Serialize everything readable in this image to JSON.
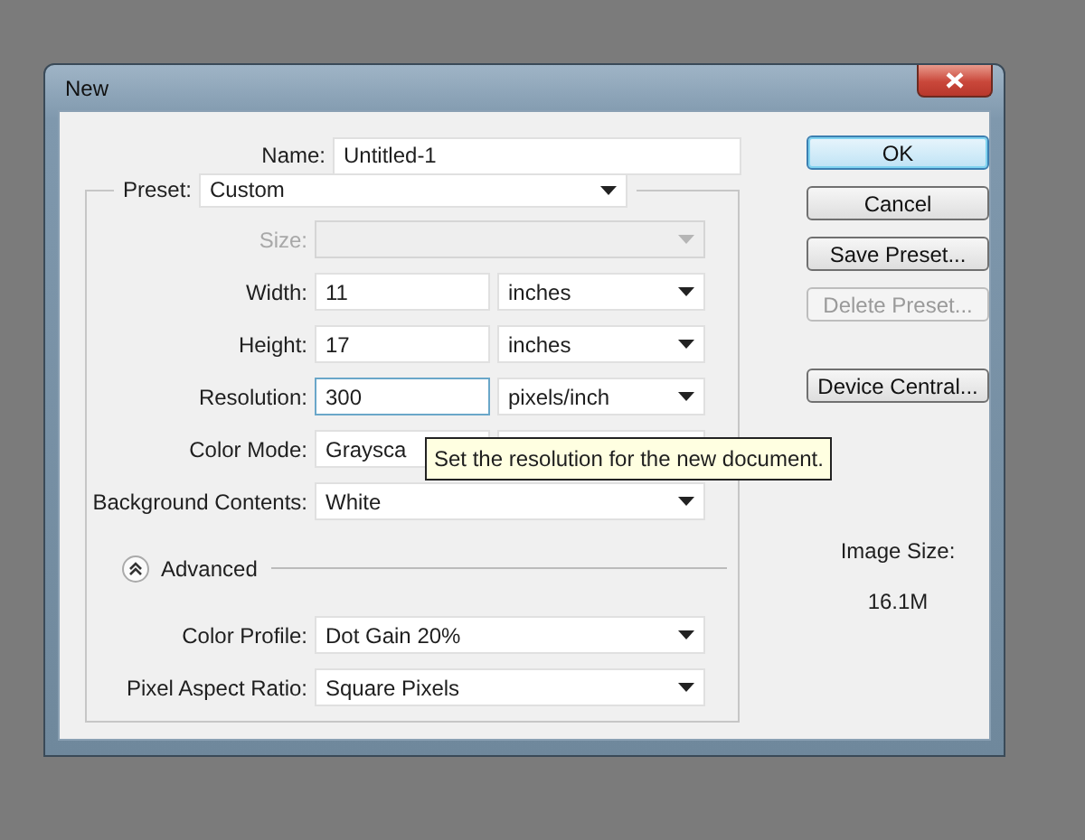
{
  "window": {
    "title": "New"
  },
  "name_field": {
    "label": "Name:",
    "value": "Untitled-1"
  },
  "preset": {
    "label": "Preset:",
    "value": "Custom"
  },
  "fields": [
    {
      "label": "Size:",
      "kind": "select",
      "disabled": true
    },
    {
      "label": "Width:",
      "kind": "pair",
      "value": "11",
      "unit": "inches",
      "focused": false
    },
    {
      "label": "Height:",
      "kind": "pair",
      "value": "17",
      "unit": "inches",
      "focused": false
    },
    {
      "label": "Resolution:",
      "kind": "pair",
      "value": "300",
      "unit": "pixels/inch",
      "focused": true
    },
    {
      "label": "Color Mode:",
      "kind": "pair",
      "value": "Graysca",
      "focused": false
    },
    {
      "label": "Background Contents:",
      "kind": "select",
      "value": "White",
      "disabled": false
    }
  ],
  "advanced": {
    "label": "Advanced",
    "expanded": true
  },
  "advanced_fields": [
    {
      "label": "Color Profile:",
      "kind": "select",
      "value": "Dot Gain 20%",
      "disabled": false
    },
    {
      "label": "Pixel Aspect Ratio:",
      "kind": "select",
      "value": "Square Pixels",
      "disabled": false
    }
  ],
  "buttons": [
    {
      "label": "OK",
      "default": true,
      "disabled": false
    },
    {
      "label": "Cancel",
      "default": false,
      "disabled": false
    },
    {
      "label": "Save Preset...",
      "default": false,
      "disabled": false
    },
    {
      "label": "Delete Preset...",
      "default": false,
      "disabled": true
    },
    {
      "label": "Device Central...",
      "default": false,
      "disabled": false
    }
  ],
  "image_size": {
    "label": "Image Size:",
    "value": "16.1M"
  },
  "tooltip": "Set the resolution for the new document."
}
